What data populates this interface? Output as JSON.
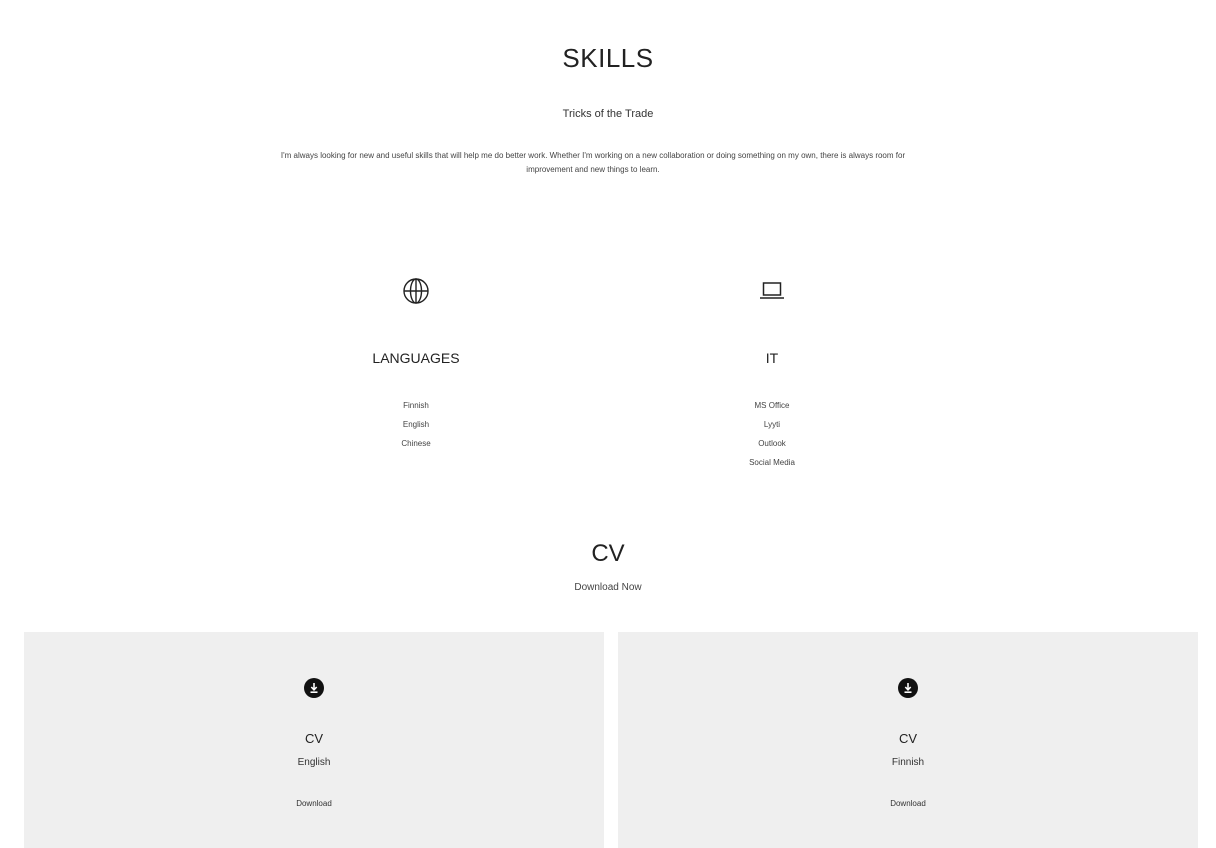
{
  "skills": {
    "title": "SKILLS",
    "subtitle": "Tricks of the Trade",
    "description": "I'm always looking for new and useful skills that will help me do better work. Whether I'm working on a new collaboration or doing something on my own, there is always room for improvement and new things to learn."
  },
  "languages": {
    "icon": "globe-icon",
    "title": "LANGUAGES",
    "items": [
      "Finnish",
      "English",
      "Chinese"
    ]
  },
  "it": {
    "icon": "laptop-icon",
    "title": "IT",
    "items": [
      "MS Office",
      "Lyyti",
      "Outlook",
      "Social Media"
    ]
  },
  "cv": {
    "title": "CV",
    "subtitle": "Download Now",
    "cards": [
      {
        "icon": "download-icon",
        "title": "CV",
        "language": "English",
        "link": "Download"
      },
      {
        "icon": "download-icon",
        "title": "CV",
        "language": "Finnish",
        "link": "Download"
      }
    ]
  }
}
